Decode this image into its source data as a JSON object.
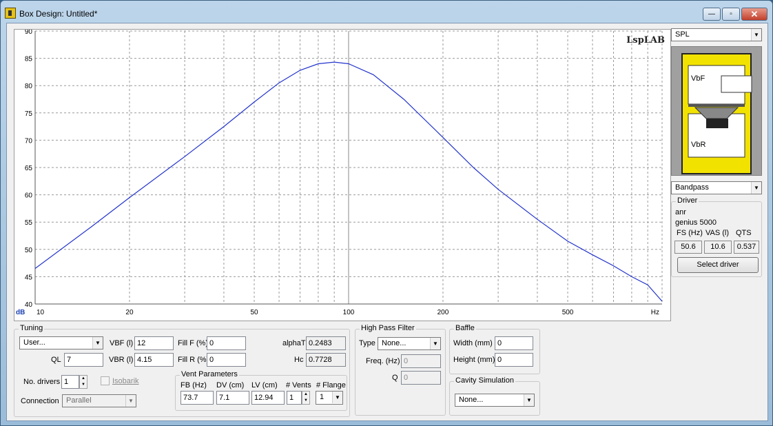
{
  "window": {
    "title": "Box Design: Untitled*",
    "minimize": "—",
    "maximize": "▫",
    "close": "✕"
  },
  "plot": {
    "watermark": "LspLAB",
    "y_unit": "dB",
    "x_unit": "Hz",
    "y_ticks": [
      "90",
      "85",
      "80",
      "75",
      "70",
      "65",
      "60",
      "55",
      "50",
      "45",
      "40"
    ],
    "x_ticks": [
      "10",
      "20",
      "50",
      "100",
      "200",
      "500"
    ],
    "chart_data": {
      "type": "line",
      "xscale": "log",
      "xlim": [
        10,
        1000
      ],
      "ylim": [
        40,
        90
      ],
      "grid": true,
      "series": [
        {
          "color": "#2233cc",
          "x": [
            10,
            15,
            20,
            30,
            40,
            50,
            60,
            70,
            80,
            90,
            100,
            120,
            150,
            200,
            250,
            300,
            400,
            500,
            600,
            700,
            800,
            900,
            1000
          ],
          "y": [
            46.5,
            54,
            59.5,
            67,
            72.5,
            77,
            80.5,
            82.8,
            84,
            84.3,
            84,
            82,
            77.5,
            70.5,
            65,
            61,
            55.5,
            51.5,
            49,
            47,
            45,
            43.5,
            40.5
          ]
        }
      ]
    }
  },
  "right_panel": {
    "graph_select": "SPL",
    "box_type": "Bandpass",
    "diagram": {
      "vbf_label": "VbF",
      "vbr_label": "VbR"
    },
    "driver": {
      "group_title": "Driver",
      "brand": "anr",
      "model": "genius 5000",
      "headers": [
        "FS (Hz)",
        "VAS (l)",
        "QTS"
      ],
      "values": [
        "50.6",
        "10.6",
        "0.537"
      ],
      "select_button": "Select driver"
    }
  },
  "tuning": {
    "group_title": "Tuning",
    "preset": "User...",
    "ql_label": "QL",
    "ql": "7",
    "vbf_label": "VBF (l)",
    "vbf": "12",
    "vbr_label": "VBR (l)",
    "vbr": "4.15",
    "fillf_label": "Fill F (%)",
    "fillf": "0",
    "fillr_label": "Fill R (%)",
    "fillr": "0",
    "alphat_label": "alphaT",
    "alphat": "0.2483",
    "hc_label": "Hc",
    "hc": "0.7728",
    "drivers_label": "No. drivers",
    "drivers": "1",
    "isobarik_label": "Isobarik",
    "connection_label": "Connection",
    "connection": "Parallel"
  },
  "vent": {
    "group_title": "Vent Parameters",
    "headers": [
      "FB (Hz)",
      "DV (cm)",
      "LV (cm)",
      "# Vents",
      "# Flange"
    ],
    "fb": "73.7",
    "dv": "7.1",
    "lv": "12.94",
    "vents": "1",
    "flange": "1"
  },
  "highpass": {
    "group_title": "High Pass Filter",
    "type_label": "Type",
    "type": "None...",
    "freq_label": "Freq. (Hz)",
    "freq": "0",
    "q_label": "Q",
    "q": "0"
  },
  "baffle": {
    "group_title": "Baffle",
    "width_label": "Width (mm)",
    "width": "0",
    "height_label": "Height (mm)",
    "height": "0"
  },
  "cavity": {
    "group_title": "Cavity Simulation",
    "value": "None..."
  }
}
